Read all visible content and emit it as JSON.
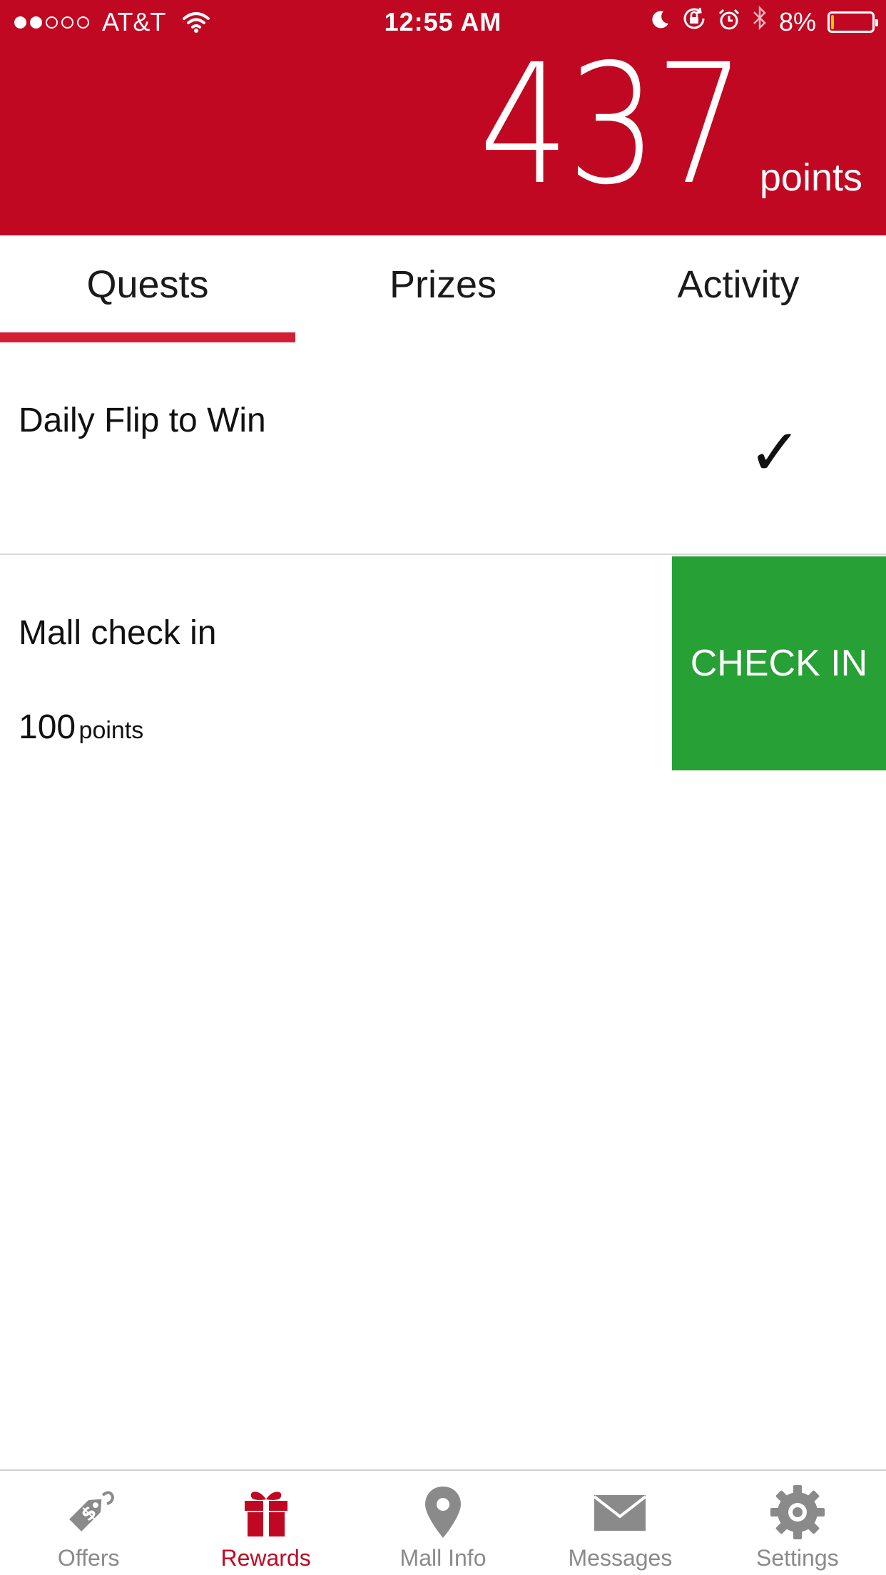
{
  "status_bar": {
    "carrier": "AT&T",
    "time": "12:55 AM",
    "battery_percent": "8%",
    "battery_level": 0.08,
    "signal_strength": 2,
    "signal_max": 5
  },
  "header": {
    "points_value": "437",
    "points_unit": "points",
    "background_color": "#c10823"
  },
  "tabs": [
    {
      "label": "Quests",
      "active": true
    },
    {
      "label": "Prizes",
      "active": false
    },
    {
      "label": "Activity",
      "active": false
    }
  ],
  "quests": {
    "daily": {
      "title": "Daily Flip to Win",
      "completed_icon": "checkmark-icon"
    },
    "checkin": {
      "title": "Mall check in",
      "points_value": "100",
      "points_unit": "points",
      "button_label": "CHECK IN",
      "button_color": "#27a035"
    }
  },
  "tabbar": [
    {
      "label": "Offers",
      "icon": "price-tag-icon",
      "active": false
    },
    {
      "label": "Rewards",
      "icon": "gift-icon",
      "active": true
    },
    {
      "label": "Mall Info",
      "icon": "location-pin-icon",
      "active": false
    },
    {
      "label": "Messages",
      "icon": "envelope-icon",
      "active": false
    },
    {
      "label": "Settings",
      "icon": "gear-icon",
      "active": false
    }
  ],
  "colors": {
    "accent": "#c10823",
    "tab_indicator": "#d31f36",
    "inactive": "#8a8a8a"
  }
}
